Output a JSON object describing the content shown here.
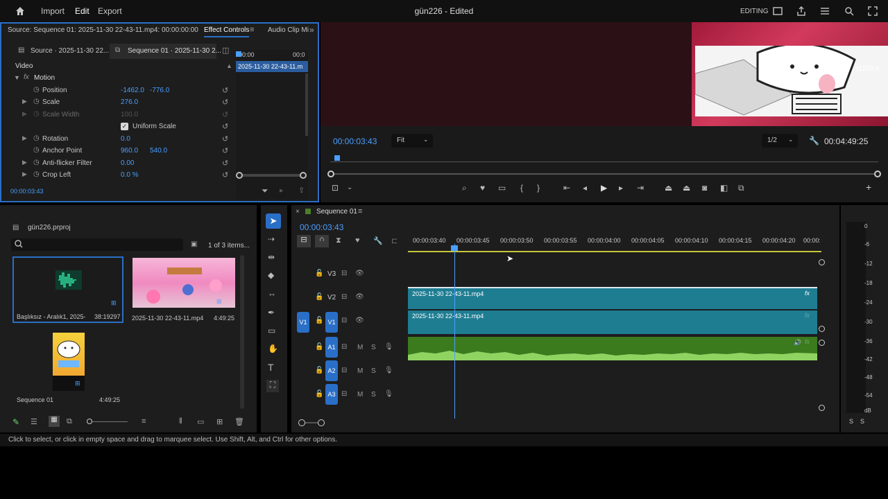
{
  "topbar": {
    "home_icon": "home-icon",
    "menu": [
      "Import",
      "Edit",
      "Export"
    ],
    "title": "gün226 - Edited",
    "workspace": "EDITING"
  },
  "effect_controls": {
    "source_label": "Source: Sequence 01: 2025-11-30 22-43-11.mp4: 00:00:00:00",
    "tabs": [
      "Effect Controls",
      "Audio Clip Mi"
    ],
    "subtab_source": "Source · 2025-11-30 22...",
    "subtab_sequence": "Sequence 01 · 2025-11-30 2...",
    "ruler_start": "00:00",
    "ruler_end": "00:0",
    "clip_label": "2025-11-30 22-43-11.m",
    "section": "Video",
    "motion": "Motion",
    "position": {
      "label": "Position",
      "x": "-1462.0",
      "y": "-776.0"
    },
    "scale": {
      "label": "Scale",
      "value": "276.0"
    },
    "scale_width": {
      "label": "Scale Width",
      "value": "100.0"
    },
    "uniform_scale": "Uniform Scale",
    "rotation": {
      "label": "Rotation",
      "value": "0.0"
    },
    "anchor": {
      "label": "Anchor Point",
      "x": "960.0",
      "y": "540.0"
    },
    "antiflicker": {
      "label": "Anti-flicker Filter",
      "value": "0.00"
    },
    "crop_left": {
      "label": "Crop Left",
      "value": "0.0 %"
    },
    "timecode": "00:00:03:43"
  },
  "program": {
    "overlay_text": "(1200 x",
    "timecode": "00:00:03:43",
    "zoom": "Fit",
    "resolution": "1/2",
    "duration": "00:04:49:25"
  },
  "project": {
    "name": "gün226.prproj",
    "count": "1 of 3 items...",
    "items": [
      {
        "name": "Başlıksız - Aralık1, 2025-...",
        "duration": "38:19297"
      },
      {
        "name": "2025-11-30 22-43-11.mp4",
        "duration": "4:49:25"
      },
      {
        "name": "Sequence 01",
        "duration": "4:49:25"
      }
    ]
  },
  "timeline": {
    "sequence_tab": "Sequence 01",
    "timecode": "00:00:03:43",
    "ticks": [
      "00:00:03:40",
      "00:00:03:45",
      "00:00:03:50",
      "00:00:03:55",
      "00:00:04:00",
      "00:00:04:05",
      "00:00:04:10",
      "00:00:04:15",
      "00:00:04:20",
      "00:00:0"
    ],
    "tracks": [
      "V3",
      "V2",
      "V1",
      "A1",
      "A2",
      "A3"
    ],
    "source_v1": "V1",
    "clip_v2": "2025-11-30 22-43-11.mp4",
    "clip_v1": "2025-11-30 22-43-11.mp4",
    "fx": "fx",
    "m": "M",
    "s": "S"
  },
  "meter": {
    "scale": [
      "0",
      "-6",
      "-12",
      "-18",
      "-24",
      "-30",
      "-36",
      "-42",
      "-48",
      "-54",
      "dB"
    ],
    "solo": [
      "S",
      "S"
    ]
  },
  "status": "Click to select, or click in empty space and drag to marquee select. Use Shift, Alt, and Ctrl for other options.",
  "colors": {
    "accent": "#2a6fc7",
    "video_clip": "#1f7d92",
    "audio_clip": "#3c7a1e",
    "timecode": "#4a9fff"
  }
}
